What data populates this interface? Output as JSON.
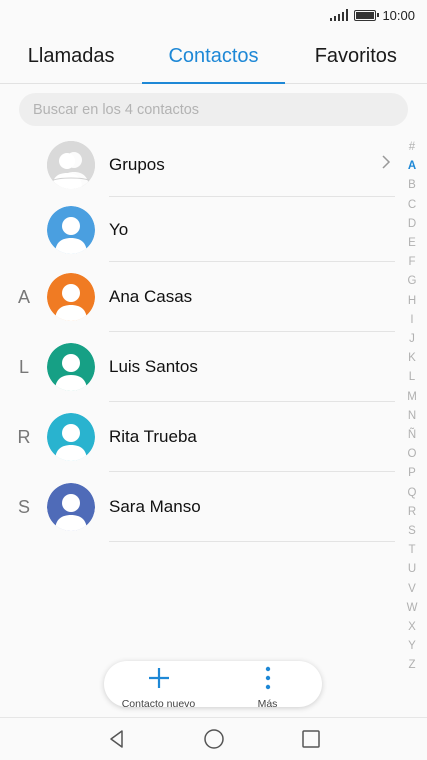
{
  "status_bar": {
    "time": "10:00"
  },
  "tabs": [
    {
      "label": "Llamadas"
    },
    {
      "label": "Contactos"
    },
    {
      "label": "Favoritos"
    }
  ],
  "search": {
    "placeholder": "Buscar en los 4 contactos"
  },
  "contacts": [
    {
      "letter": "",
      "name": "Grupos",
      "avatar_color": "#c8c8c8",
      "icon": "group-avatar-icon"
    },
    {
      "letter": "",
      "name": "Yo",
      "avatar_color": "#4a9fe0",
      "icon": "person-avatar-icon"
    },
    {
      "letter": "A",
      "name": "Ana Casas",
      "avatar_color": "#f07b23",
      "icon": "person-avatar-icon"
    },
    {
      "letter": "L",
      "name": "Luis Santos",
      "avatar_color": "#16a085",
      "icon": "person-avatar-icon"
    },
    {
      "letter": "R",
      "name": "Rita Trueba",
      "avatar_color": "#29b3cf",
      "icon": "person-avatar-icon"
    },
    {
      "letter": "S",
      "name": "Sara Manso",
      "avatar_color": "#4f6bb8",
      "icon": "person-avatar-icon"
    }
  ],
  "alpha_index": [
    "#",
    "A",
    "B",
    "C",
    "D",
    "E",
    "F",
    "G",
    "H",
    "I",
    "J",
    "K",
    "L",
    "M",
    "N",
    "Ñ",
    "O",
    "P",
    "Q",
    "R",
    "S",
    "T",
    "U",
    "V",
    "W",
    "X",
    "Y",
    "Z"
  ],
  "alpha_active": "A",
  "fab": {
    "new_contact_label": "Contacto nuevo",
    "more_label": "Más"
  },
  "colors": {
    "accent": "#1e88d6"
  }
}
